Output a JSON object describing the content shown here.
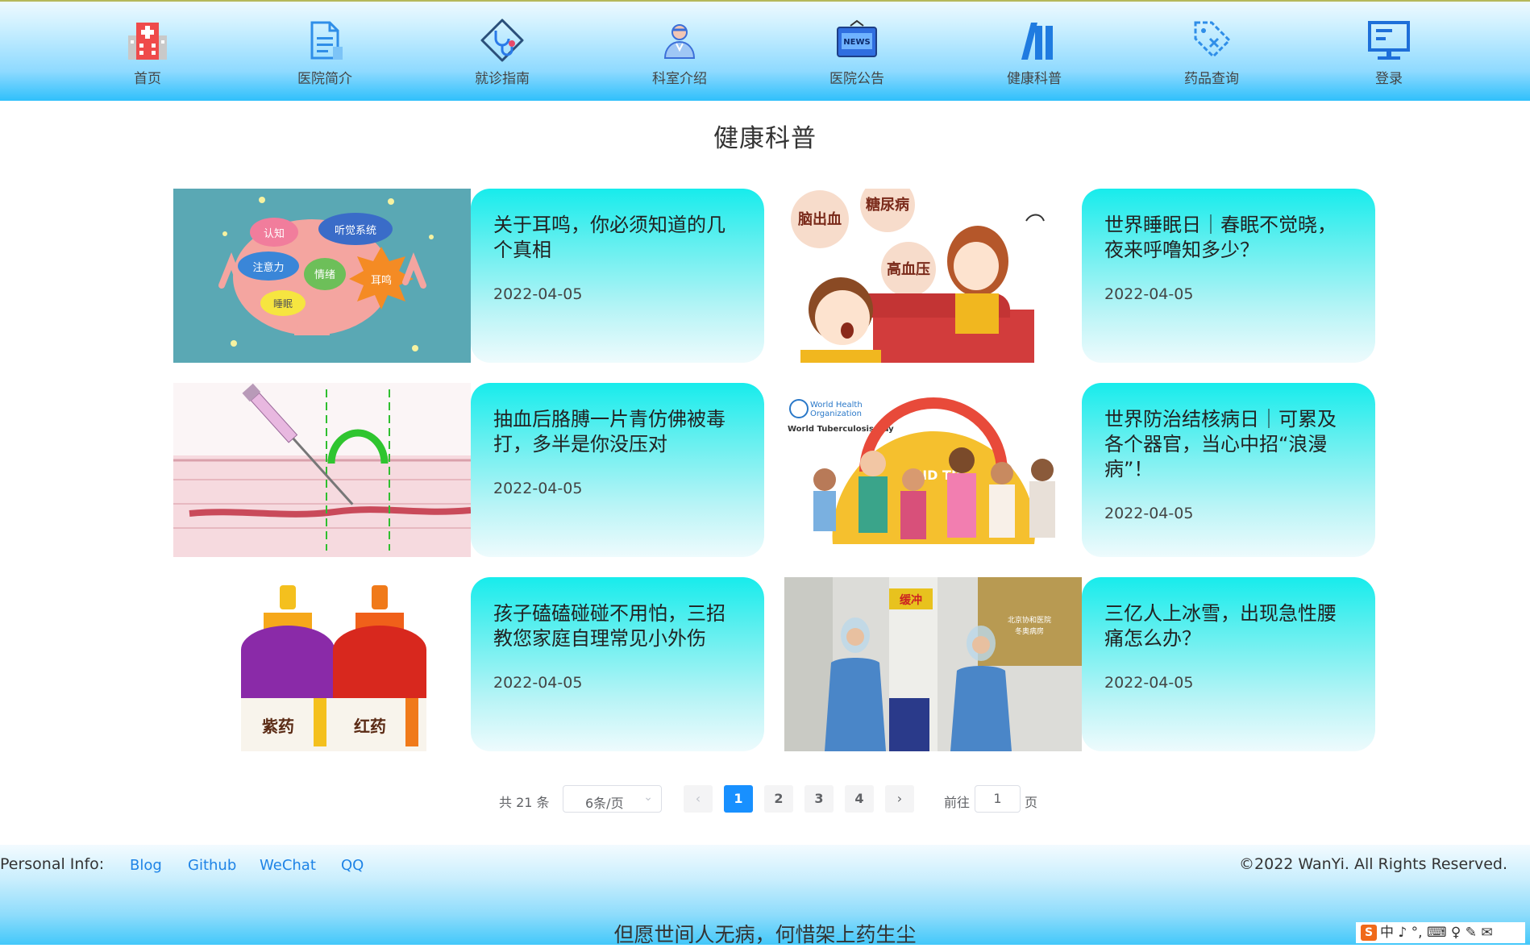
{
  "nav": [
    {
      "label": "首页",
      "icon": "hospital-icon"
    },
    {
      "label": "医院简介",
      "icon": "document-icon"
    },
    {
      "label": "就诊指南",
      "icon": "stethoscope-icon"
    },
    {
      "label": "科室介绍",
      "icon": "doctor-icon"
    },
    {
      "label": "医院公告",
      "icon": "news-icon"
    },
    {
      "label": "健康科普",
      "icon": "chart-bars-icon"
    },
    {
      "label": "药品查询",
      "icon": "tag-icon"
    },
    {
      "label": "登录",
      "icon": "monitor-icon"
    }
  ],
  "page": {
    "title": "健康科普"
  },
  "cards": [
    {
      "title": "关于耳鸣，你必须知道的几个真相",
      "date": "2022-04-05",
      "image_text": [
        "认知",
        "听觉系统",
        "注意力",
        "情绪",
        "耳鸣",
        "睡眠"
      ]
    },
    {
      "title": "世界睡眠日｜春眠不觉晓，夜来呼噜知多少？",
      "date": "2022-04-05",
      "image_text": [
        "脑出血",
        "糖尿病",
        "高血压"
      ]
    },
    {
      "title": "抽血后胳膊一片青仿佛被毒打，多半是你没压对",
      "date": "2022-04-05",
      "image_text": []
    },
    {
      "title": "世界防治结核病日｜可累及各个器官，当心中招“浪漫病”！",
      "date": "2022-04-05",
      "image_text": [
        "World Health",
        "Organization",
        "World Tuberculosis Day",
        "END TB"
      ]
    },
    {
      "title": "孩子磕磕碰碰不用怕，三招教您家庭自理常见小外伤",
      "date": "2022-04-05",
      "image_text": [
        "紫药",
        "红药"
      ]
    },
    {
      "title": "三亿人上冰雪，出现急性腰痛怎么办？",
      "date": "2022-04-05",
      "image_text": [
        "缓冲",
        "北京协和医院",
        "冬奥病房"
      ]
    }
  ],
  "pagination": {
    "total": "共 21 条",
    "page_size": "6条/页",
    "pages": [
      "1",
      "2",
      "3",
      "4"
    ],
    "current_page": "1",
    "prev": "‹",
    "next": "›",
    "goto_label": "前往",
    "goto_value": "1",
    "goto_unit": "页"
  },
  "footer": {
    "personal_info": "Personal Info:",
    "links": [
      "Blog",
      "Github",
      "WeChat",
      "QQ"
    ],
    "copyright": "©2022 WanYi. All Rights Reserved.",
    "slogan": "但愿世间人无病，何惜架上药生尘"
  },
  "ime": {
    "logo": "S",
    "text": "中 ♪ °, ⌨ ♀ ✎ ✉"
  },
  "colors": {
    "accent": "#1890ff",
    "card_gradient_top": "#17ecec",
    "link": "#1e83e6"
  }
}
